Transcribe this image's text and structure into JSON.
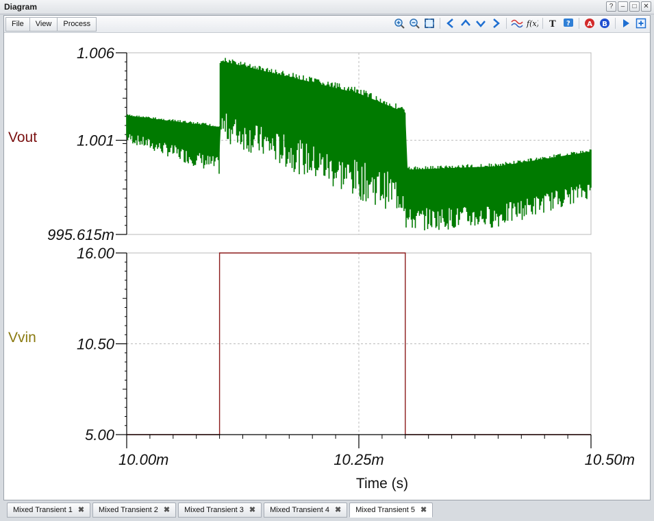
{
  "window": {
    "title": "Diagram",
    "buttons": [
      "?",
      "–",
      "□",
      "✕"
    ]
  },
  "menu": {
    "items": [
      "File",
      "View",
      "Process"
    ]
  },
  "toolbar": {
    "icons": [
      "zoom-in-icon",
      "zoom-out-icon",
      "fit-icon",
      "pan-left-icon",
      "pan-up-icon",
      "pan-down-icon",
      "pan-right-icon",
      "waveform-icon",
      "function-icon",
      "text-icon",
      "help-icon",
      "cursor-a-icon",
      "cursor-b-icon",
      "run-icon",
      "add-window-icon"
    ]
  },
  "tabs": [
    {
      "label": "Mixed Transient 1",
      "active": false
    },
    {
      "label": "Mixed Transient 2",
      "active": false
    },
    {
      "label": "Mixed Transient 3",
      "active": false
    },
    {
      "label": "Mixed Transient 4",
      "active": false
    },
    {
      "label": "Mixed Transient 5",
      "active": true
    }
  ],
  "chart_data": [
    {
      "type": "line",
      "ylabel": "Vout",
      "ylim": [
        0.995615,
        1.006
      ],
      "y_ticks": [
        "1.006",
        "1.001",
        "995.615m"
      ],
      "x_ticks": [
        "10.00m",
        "10.25m",
        "10.50m"
      ],
      "xlabel": "Time (s)",
      "color": "#007a00",
      "label_color": "#7a1010",
      "series": [
        {
          "x_unit": "s",
          "x": [
            0.01,
            0.0101,
            0.0101,
            0.01025,
            0.0103,
            0.0103,
            0.0104,
            0.0105
          ],
          "y_high": [
            1.0025,
            1.0019,
            1.0058,
            1.004,
            1.0029,
            0.9995,
            0.9997,
            1.0005
          ],
          "y_low": [
            1.0009,
            0.999,
            1.001,
            0.9976,
            0.9967,
            0.9958,
            0.996,
            0.9977
          ]
        }
      ]
    },
    {
      "type": "line",
      "ylabel": "Vvin",
      "ylim": [
        5.0,
        16.0
      ],
      "y_ticks": [
        "16.00",
        "10.50",
        "5.00"
      ],
      "x_ticks": [
        "10.00m",
        "10.25m",
        "10.50m"
      ],
      "xlabel": "Time (s)",
      "color": "#8b1a1a",
      "label_color": "#8a7a10",
      "series": [
        {
          "x_unit": "s",
          "x": [
            0.01,
            0.0101,
            0.0101,
            0.0103,
            0.0103,
            0.0105
          ],
          "y": [
            5.0,
            5.0,
            16.0,
            16.0,
            5.0,
            5.0
          ]
        }
      ]
    }
  ]
}
